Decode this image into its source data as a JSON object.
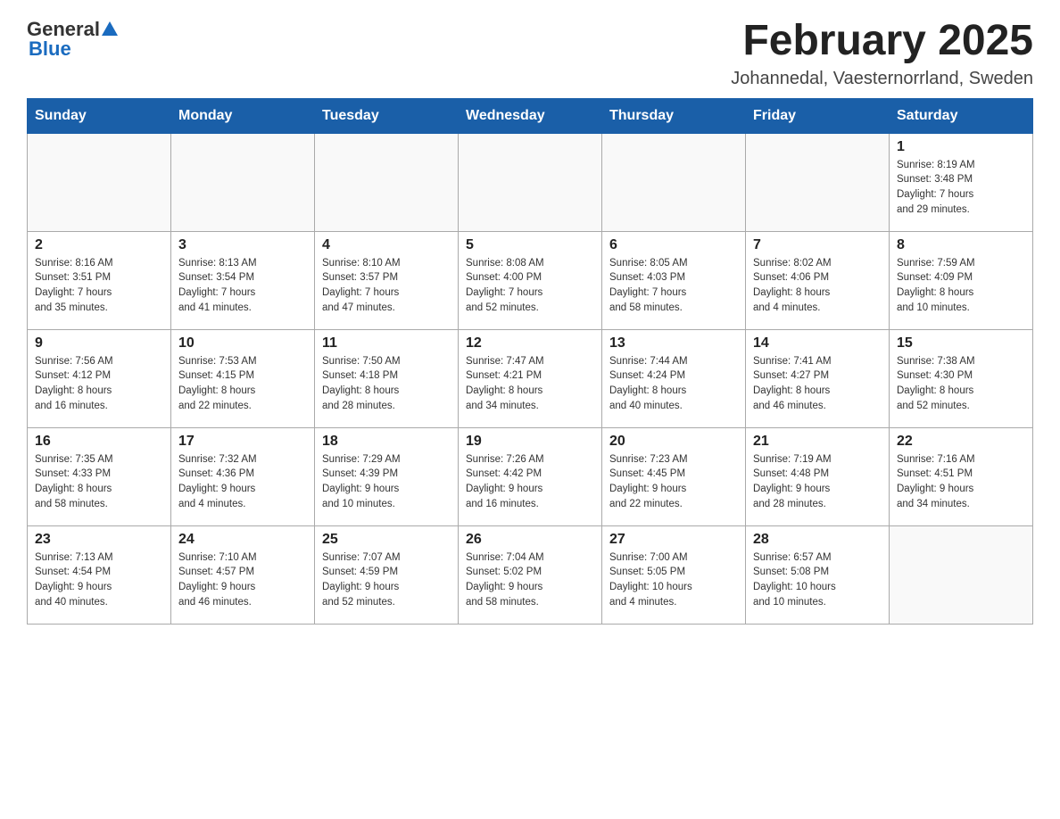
{
  "header": {
    "logo": {
      "general": "General",
      "blue": "Blue"
    },
    "title": "February 2025",
    "subtitle": "Johannedal, Vaesternorrland, Sweden"
  },
  "weekdays": [
    "Sunday",
    "Monday",
    "Tuesday",
    "Wednesday",
    "Thursday",
    "Friday",
    "Saturday"
  ],
  "weeks": [
    [
      {
        "day": "",
        "info": ""
      },
      {
        "day": "",
        "info": ""
      },
      {
        "day": "",
        "info": ""
      },
      {
        "day": "",
        "info": ""
      },
      {
        "day": "",
        "info": ""
      },
      {
        "day": "",
        "info": ""
      },
      {
        "day": "1",
        "info": "Sunrise: 8:19 AM\nSunset: 3:48 PM\nDaylight: 7 hours\nand 29 minutes."
      }
    ],
    [
      {
        "day": "2",
        "info": "Sunrise: 8:16 AM\nSunset: 3:51 PM\nDaylight: 7 hours\nand 35 minutes."
      },
      {
        "day": "3",
        "info": "Sunrise: 8:13 AM\nSunset: 3:54 PM\nDaylight: 7 hours\nand 41 minutes."
      },
      {
        "day": "4",
        "info": "Sunrise: 8:10 AM\nSunset: 3:57 PM\nDaylight: 7 hours\nand 47 minutes."
      },
      {
        "day": "5",
        "info": "Sunrise: 8:08 AM\nSunset: 4:00 PM\nDaylight: 7 hours\nand 52 minutes."
      },
      {
        "day": "6",
        "info": "Sunrise: 8:05 AM\nSunset: 4:03 PM\nDaylight: 7 hours\nand 58 minutes."
      },
      {
        "day": "7",
        "info": "Sunrise: 8:02 AM\nSunset: 4:06 PM\nDaylight: 8 hours\nand 4 minutes."
      },
      {
        "day": "8",
        "info": "Sunrise: 7:59 AM\nSunset: 4:09 PM\nDaylight: 8 hours\nand 10 minutes."
      }
    ],
    [
      {
        "day": "9",
        "info": "Sunrise: 7:56 AM\nSunset: 4:12 PM\nDaylight: 8 hours\nand 16 minutes."
      },
      {
        "day": "10",
        "info": "Sunrise: 7:53 AM\nSunset: 4:15 PM\nDaylight: 8 hours\nand 22 minutes."
      },
      {
        "day": "11",
        "info": "Sunrise: 7:50 AM\nSunset: 4:18 PM\nDaylight: 8 hours\nand 28 minutes."
      },
      {
        "day": "12",
        "info": "Sunrise: 7:47 AM\nSunset: 4:21 PM\nDaylight: 8 hours\nand 34 minutes."
      },
      {
        "day": "13",
        "info": "Sunrise: 7:44 AM\nSunset: 4:24 PM\nDaylight: 8 hours\nand 40 minutes."
      },
      {
        "day": "14",
        "info": "Sunrise: 7:41 AM\nSunset: 4:27 PM\nDaylight: 8 hours\nand 46 minutes."
      },
      {
        "day": "15",
        "info": "Sunrise: 7:38 AM\nSunset: 4:30 PM\nDaylight: 8 hours\nand 52 minutes."
      }
    ],
    [
      {
        "day": "16",
        "info": "Sunrise: 7:35 AM\nSunset: 4:33 PM\nDaylight: 8 hours\nand 58 minutes."
      },
      {
        "day": "17",
        "info": "Sunrise: 7:32 AM\nSunset: 4:36 PM\nDaylight: 9 hours\nand 4 minutes."
      },
      {
        "day": "18",
        "info": "Sunrise: 7:29 AM\nSunset: 4:39 PM\nDaylight: 9 hours\nand 10 minutes."
      },
      {
        "day": "19",
        "info": "Sunrise: 7:26 AM\nSunset: 4:42 PM\nDaylight: 9 hours\nand 16 minutes."
      },
      {
        "day": "20",
        "info": "Sunrise: 7:23 AM\nSunset: 4:45 PM\nDaylight: 9 hours\nand 22 minutes."
      },
      {
        "day": "21",
        "info": "Sunrise: 7:19 AM\nSunset: 4:48 PM\nDaylight: 9 hours\nand 28 minutes."
      },
      {
        "day": "22",
        "info": "Sunrise: 7:16 AM\nSunset: 4:51 PM\nDaylight: 9 hours\nand 34 minutes."
      }
    ],
    [
      {
        "day": "23",
        "info": "Sunrise: 7:13 AM\nSunset: 4:54 PM\nDaylight: 9 hours\nand 40 minutes."
      },
      {
        "day": "24",
        "info": "Sunrise: 7:10 AM\nSunset: 4:57 PM\nDaylight: 9 hours\nand 46 minutes."
      },
      {
        "day": "25",
        "info": "Sunrise: 7:07 AM\nSunset: 4:59 PM\nDaylight: 9 hours\nand 52 minutes."
      },
      {
        "day": "26",
        "info": "Sunrise: 7:04 AM\nSunset: 5:02 PM\nDaylight: 9 hours\nand 58 minutes."
      },
      {
        "day": "27",
        "info": "Sunrise: 7:00 AM\nSunset: 5:05 PM\nDaylight: 10 hours\nand 4 minutes."
      },
      {
        "day": "28",
        "info": "Sunrise: 6:57 AM\nSunset: 5:08 PM\nDaylight: 10 hours\nand 10 minutes."
      },
      {
        "day": "",
        "info": ""
      }
    ]
  ]
}
